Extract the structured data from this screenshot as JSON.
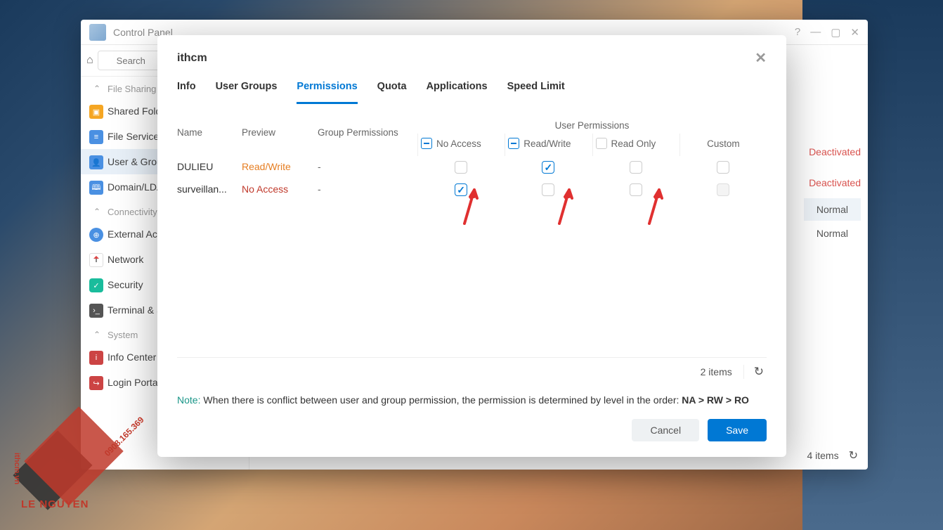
{
  "control_panel": {
    "title": "Control Panel",
    "search_placeholder": "Search",
    "sections": {
      "file_sharing": "File Sharing",
      "connectivity": "Connectivity",
      "system": "System"
    },
    "items": {
      "shared_folder": "Shared Folders",
      "file_services": "File Services",
      "user_group": "User & Group",
      "domain_ldap": "Domain/LDAP",
      "external_access": "External Access",
      "network": "Network",
      "security": "Security",
      "terminal": "Terminal & SNMP",
      "info_center": "Info Center",
      "login_portal": "Login Portal"
    },
    "right_status": {
      "deactivated1": "Deactivated",
      "deactivated2": "Deactivated",
      "normal1": "Normal",
      "normal2": "Normal"
    },
    "footer_items": "4 items"
  },
  "modal": {
    "title": "ithcm",
    "tabs": {
      "info": "Info",
      "user_groups": "User Groups",
      "permissions": "Permissions",
      "quota": "Quota",
      "applications": "Applications",
      "speed_limit": "Speed Limit"
    },
    "headers": {
      "name": "Name",
      "preview": "Preview",
      "group_permissions": "Group Permissions",
      "user_permissions": "User Permissions",
      "no_access": "No Access",
      "read_write": "Read/Write",
      "read_only": "Read Only",
      "custom": "Custom"
    },
    "rows": [
      {
        "name": "DULIEU",
        "preview": "Read/Write",
        "preview_class": "rw",
        "group": "-",
        "no_access": false,
        "read_write": true,
        "read_only": false,
        "custom": false
      },
      {
        "name": "surveillance",
        "preview": "No Access",
        "preview_class": "na",
        "group": "-",
        "no_access": true,
        "read_write": false,
        "read_only": false,
        "custom": false,
        "custom_disabled": true
      }
    ],
    "footer_items": "2 items",
    "note_label": "Note:",
    "note_text": "When there is conflict between user and group permission, the permission is determined by level in the order:",
    "note_order": "NA > RW > RO",
    "cancel": "Cancel",
    "save": "Save"
  },
  "watermark": {
    "brand": "LE NGUYEN",
    "phone": "0908.165.369",
    "site": "ithcm.vn"
  }
}
